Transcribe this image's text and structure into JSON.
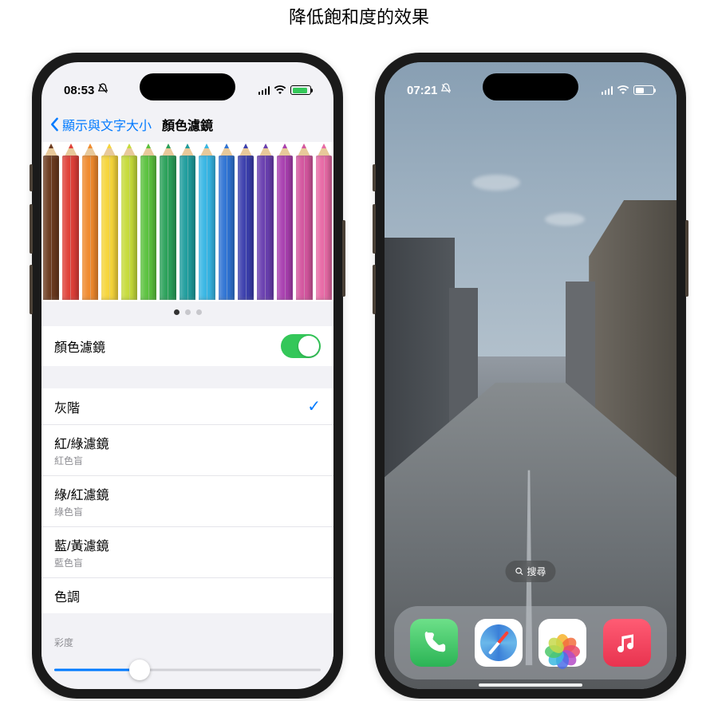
{
  "caption": "降低飽和度的效果",
  "left_phone": {
    "status": {
      "time": "08:53",
      "silent": true,
      "charging": true
    },
    "nav": {
      "back": "顯示與文字大小",
      "title": "顏色濾鏡"
    },
    "pencil_colors": [
      "#6c3b1f",
      "#e04038",
      "#f08a2c",
      "#f6d53a",
      "#c6db3a",
      "#5bc23e",
      "#2aa15a",
      "#1f9d9d",
      "#37b6e4",
      "#2f74d4",
      "#3b3fae",
      "#6a3fb0",
      "#a93fb0",
      "#d4569f",
      "#e86aa6"
    ],
    "toggle": {
      "label": "顏色濾鏡",
      "on": true
    },
    "options": [
      {
        "label": "灰階",
        "subtitle": "",
        "selected": true
      },
      {
        "label": "紅/綠濾鏡",
        "subtitle": "紅色盲",
        "selected": false
      },
      {
        "label": "綠/紅濾鏡",
        "subtitle": "綠色盲",
        "selected": false
      },
      {
        "label": "藍/黃濾鏡",
        "subtitle": "藍色盲",
        "selected": false
      },
      {
        "label": "色調",
        "subtitle": "",
        "selected": false
      }
    ],
    "slider": {
      "label": "彩度",
      "value": 0.32
    }
  },
  "right_phone": {
    "status": {
      "time": "07:21",
      "silent": true
    },
    "search": "搜尋",
    "dock": {
      "phone": "Phone",
      "safari": "Safari",
      "photos": "Photos",
      "music": "Music"
    }
  }
}
